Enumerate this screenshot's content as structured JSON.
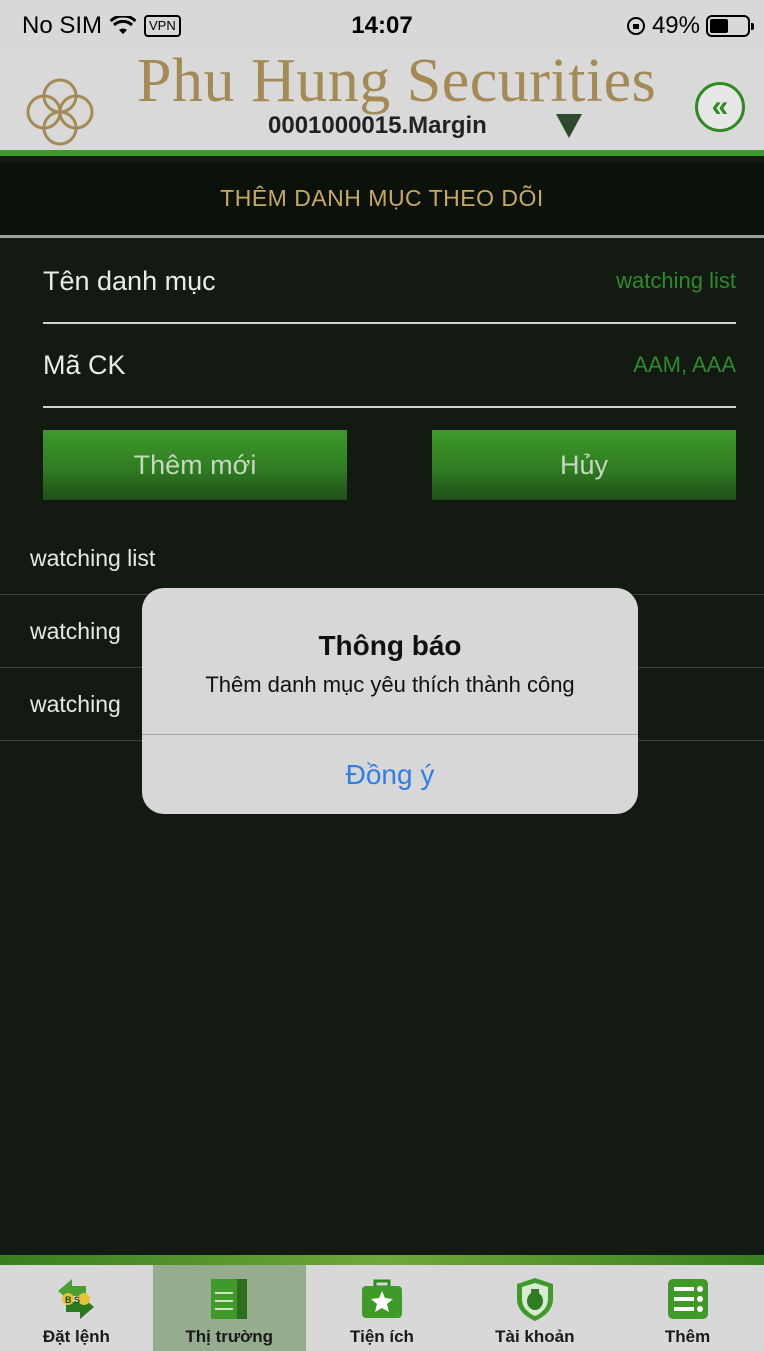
{
  "status": {
    "carrier": "No SIM",
    "vpn": "VPN",
    "time": "14:07",
    "battery": "49%",
    "battery_level": 0.49
  },
  "header": {
    "brand": "Phu Hung Securities",
    "account": "0001000015.Margin"
  },
  "title": "THÊM DANH MỤC THEO DÕI",
  "form": {
    "name_label": "Tên danh mục",
    "name_value": "watching list",
    "code_label": "Mã CK",
    "code_value": "AAM, AAA"
  },
  "buttons": {
    "add": "Thêm mới",
    "cancel": "Hủy"
  },
  "list": [
    {
      "label": "watching list"
    },
    {
      "label": "watching"
    },
    {
      "label": "watching"
    }
  ],
  "alert": {
    "title": "Thông báo",
    "message": "Thêm danh mục yêu thích thành công",
    "ok": "Đồng ý"
  },
  "tabs": [
    {
      "label": "Đặt lệnh",
      "icon": "buy-sell-icon",
      "badge": "B S"
    },
    {
      "label": "Thị trường",
      "icon": "market-board-icon"
    },
    {
      "label": "Tiện ích",
      "icon": "star-kit-icon"
    },
    {
      "label": "Tài khoản",
      "icon": "money-shield-icon"
    },
    {
      "label": "Thêm",
      "icon": "more-menu-icon"
    }
  ],
  "colors": {
    "accent": "#2f8a2a",
    "brand": "#a48a55",
    "link": "#2f7fe6",
    "background": "#121a12"
  }
}
